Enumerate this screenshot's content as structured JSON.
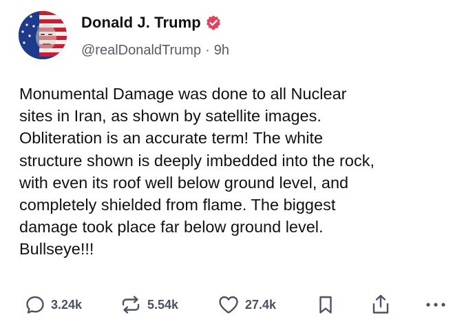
{
  "author": {
    "display_name": "Donald J. Trump",
    "handle": "@realDonaldTrump",
    "separator": "·",
    "time_ago": "9h",
    "verified": true
  },
  "post": {
    "text": "Monumental Damage was done to all Nuclear\nsites in Iran, as shown by satellite images.\nObliteration is an accurate term! The white\nstructure shown is deeply imbedded into the rock,\nwith even its roof well below ground level, and\ncompletely shielded from flame. The biggest\ndamage took place far below ground level.\nBullseye!!!"
  },
  "actions": {
    "replies": "3.24k",
    "reposts": "5.54k",
    "likes": "27.4k"
  },
  "icons": {
    "reply": "speech-bubble-icon",
    "repost": "repost-arrows-icon",
    "like": "heart-icon",
    "save": "bookmark-icon",
    "share": "share-upload-icon",
    "more": "more-dots-icon",
    "verified": "verified-badge-icon"
  },
  "colors": {
    "verified_badge": "#e5405e",
    "text_primary": "#111111",
    "text_secondary": "#555b66",
    "icon": "#4a5160"
  }
}
